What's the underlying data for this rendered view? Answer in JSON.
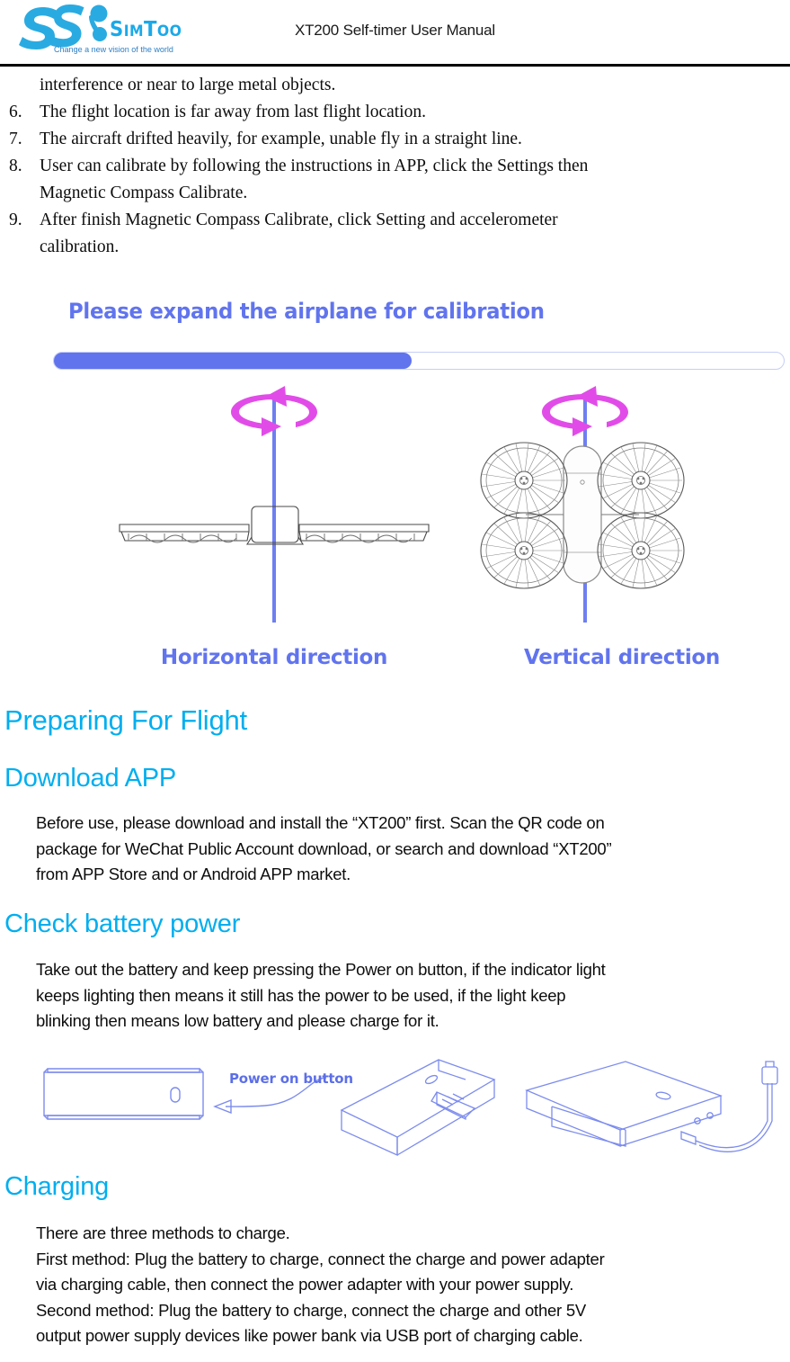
{
  "header": {
    "logo_name": "SimToo",
    "logo_tagline": "Change a new vision of the world",
    "document_title": "XT200 Self-timer User Manual"
  },
  "numbered_list": {
    "continuation_line": "interference or near to large metal objects.",
    "items": [
      {
        "num": "6.",
        "lines": [
          "The flight location is far away from last flight location."
        ]
      },
      {
        "num": "7.",
        "lines": [
          "The aircraft drifted heavily, for example, unable fly in a straight line."
        ]
      },
      {
        "num": "8.",
        "lines": [
          "User can calibrate by following the instructions in APP, click the Settings then",
          "Magnetic Compass Calibrate."
        ]
      },
      {
        "num": "9.",
        "lines": [
          "After finish Magnetic Compass Calibrate, click Setting and accelerometer",
          "calibration."
        ]
      }
    ]
  },
  "calibration_figure": {
    "title": "Please expand the airplane for calibration",
    "progress_percent": 49,
    "progress_fill_color": "#6174EE",
    "progress_track_color": "#C5CEF7",
    "rotation_arrow_color": "#E14CE8",
    "axis_color": "#6E7FF0",
    "left_label": "Horizontal direction",
    "right_label": "Vertical direction"
  },
  "sections": [
    {
      "id": "preparing-for-flight",
      "heading": "Preparing For Flight",
      "level": "h1"
    },
    {
      "id": "download-app",
      "heading": "Download APP",
      "level": "h2",
      "paragraph_lines": [
        "Before use, please download and install the “XT200” first. Scan the QR code on",
        "package for WeChat Public Account download, or search and download “XT200”",
        "from APP Store and or Android APP market."
      ]
    },
    {
      "id": "check-battery-power",
      "heading": "Check battery power",
      "level": "h2",
      "paragraph_lines": [
        "Take out the battery and keep pressing the Power on button, if the indicator light",
        "keeps lighting then means it still has the power to be used, if the light keep",
        "blinking then means low battery and please charge for it."
      ]
    },
    {
      "id": "charging",
      "heading": "Charging",
      "level": "h2",
      "paragraph_lines": [
        "There are three methods to charge.",
        "First method: Plug the battery to charge, connect the charge and power adapter",
        "via charging cable, then connect the power adapter with your power supply.",
        "Second method: Plug the battery to charge, connect the charge and other 5V",
        "output power supply devices like power bank via USB port of charging cable."
      ]
    }
  ],
  "battery_figure": {
    "power_on_button_label": "Power on button",
    "line_color": "#7C8CEE"
  },
  "colors": {
    "heading_blue": "#00AEEF",
    "figure_blue": "#6174EE",
    "magenta": "#E14CE8",
    "logo_blue": "#1BA9E8"
  }
}
